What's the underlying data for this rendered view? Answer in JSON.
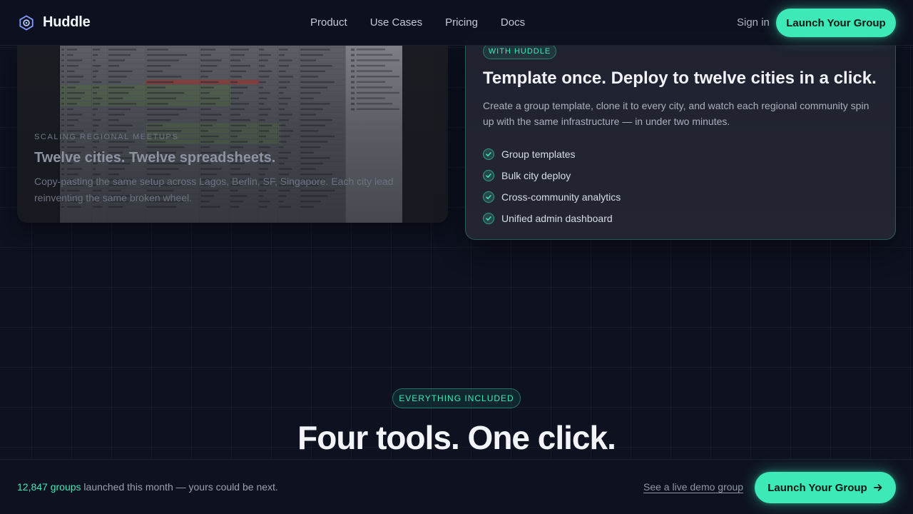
{
  "nav": {
    "brand": "Huddle",
    "links": [
      "Product",
      "Use Cases",
      "Pricing",
      "Docs"
    ],
    "signin": "Sign in",
    "cta": "Launch Your Group"
  },
  "before": {
    "eyebrow": "SCALING REGIONAL MEETUPS",
    "title": "Twelve cities. Twelve spreadsheets.",
    "description": "Copy-pasting the same setup across Lagos, Berlin, SF, Singapore. Each city lead reinventing the same broken wheel."
  },
  "after": {
    "badge": "WITH HUDDLE",
    "title": "Template once. Deploy to twelve cities in a click.",
    "description": "Create a group template, clone it to every city, and watch each regional community spin up with the same infrastructure — in under two minutes.",
    "features": [
      "Group templates",
      "Bulk city deploy",
      "Cross-community analytics",
      "Unified admin dashboard"
    ]
  },
  "section": {
    "badge": "EVERYTHING INCLUDED",
    "title": "Four tools. One click."
  },
  "footer": {
    "count": "12,847 groups",
    "text": " launched this month — yours could be next.",
    "demo_link": "See a live demo group",
    "cta": "Launch Your Group"
  },
  "colors": {
    "accent": "#3de9b7",
    "background": "#0d1120",
    "card": "#232433"
  },
  "icons": {
    "logo": "hexagon-gear-logo-icon",
    "check": "check-circle-icon",
    "arrow": "arrow-right-icon"
  }
}
